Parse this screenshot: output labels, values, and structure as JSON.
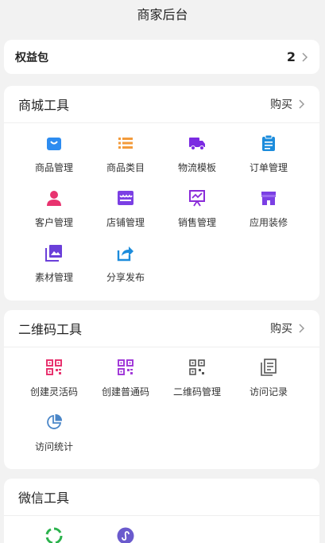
{
  "header": {
    "title": "商家后台"
  },
  "benefit": {
    "label": "权益包",
    "count": "2"
  },
  "mall_tools": {
    "title": "商城工具",
    "action": "购买",
    "items": [
      {
        "label": "商品管理",
        "icon": "shopping-bag-icon",
        "color": "#2d8cf0"
      },
      {
        "label": "商品类目",
        "icon": "list-icon",
        "color": "#f39b3b"
      },
      {
        "label": "物流模板",
        "icon": "truck-icon",
        "color": "#7b2be2"
      },
      {
        "label": "订单管理",
        "icon": "clipboard-icon",
        "color": "#1c8cdc"
      },
      {
        "label": "客户管理",
        "icon": "user-icon",
        "color": "#e8336f"
      },
      {
        "label": "店铺管理",
        "icon": "store-icon",
        "color": "#7b3fe4"
      },
      {
        "label": "销售管理",
        "icon": "presentation-chart-icon",
        "color": "#8a2bd9"
      },
      {
        "label": "应用装修",
        "icon": "shop-front-icon",
        "color": "#7b3fe4"
      },
      {
        "label": "素材管理",
        "icon": "image-library-icon",
        "color": "#6b3fd9"
      },
      {
        "label": "分享发布",
        "icon": "share-icon",
        "color": "#1c8cdc"
      }
    ]
  },
  "qr_tools": {
    "title": "二维码工具",
    "action": "购买",
    "items": [
      {
        "label": "创建灵活码",
        "icon": "qr-code-icon",
        "color": "#e8336f"
      },
      {
        "label": "创建普通码",
        "icon": "qr-code-icon",
        "color": "#a23bd9"
      },
      {
        "label": "二维码管理",
        "icon": "qr-code-icon",
        "color": "#555555"
      },
      {
        "label": "访问记录",
        "icon": "document-list-icon",
        "color": "#555555"
      },
      {
        "label": "访问统计",
        "icon": "pie-chart-icon",
        "color": "#4a86c8"
      }
    ]
  },
  "wechat_tools": {
    "title": "微信工具",
    "items": [
      {
        "label": "",
        "icon": "wechat-pay-icon",
        "color": "#2bb24c"
      },
      {
        "label": "",
        "icon": "mini-program-icon",
        "color": "#6a5acd"
      }
    ]
  }
}
